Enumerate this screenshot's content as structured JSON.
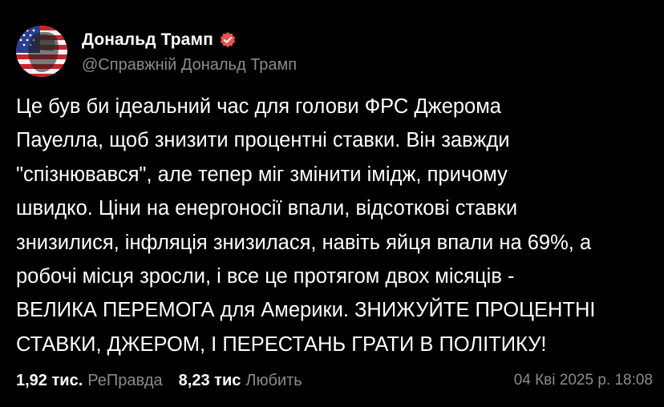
{
  "author": {
    "name": "Дональд Трамп",
    "handle": "@Справжній Дональд Трамп",
    "verified_color": "#e8554e"
  },
  "post": {
    "lines": [
      "Це був би ідеальний час для голови ФРС Джерома",
      "Пауелла, щоб знизити процентні ставки. Він завжди",
      "\"спізнювався\", але тепер міг змінити імідж, причому",
      "швидко. Ціни на енергоносії впали, відсоткові ставки",
      "знизилися, інфляція знизилася, навіть яйця впали на 69%, а",
      "робочі місця зросли, і все це протягом двох місяців -",
      "ВЕЛИКА ПЕРЕМОГА для Америки. ЗНИЖУЙТЕ ПРОЦЕНТНІ",
      "СТАВКИ, ДЖЕРОМ, І ПЕРЕСТАНЬ ГРАТИ В ПОЛІТИКУ!"
    ]
  },
  "stats": {
    "reposts_count": "1,92 тис.",
    "reposts_label": "РеПравда",
    "likes_count": "8,23 тис",
    "likes_label": "Любить"
  },
  "timestamp": "04 Кві 2025 р. 18:08",
  "colors": {
    "background": "#000000",
    "text": "#ffffff",
    "muted": "#8b8b8b"
  }
}
